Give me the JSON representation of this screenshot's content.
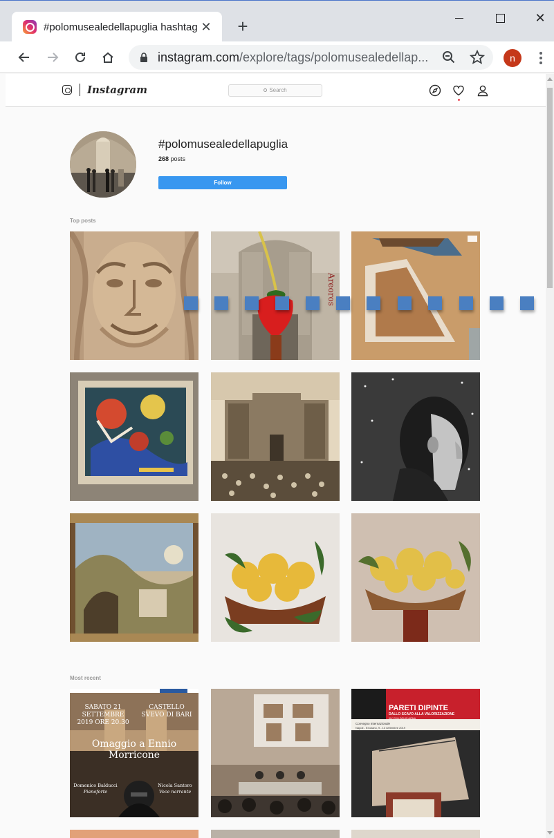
{
  "browser": {
    "tab_title": "#polomusealedellapuglia hashtag",
    "url_host": "instagram.com",
    "url_path": "/explore/tags/polomusealedellap...",
    "profile_initial": "n",
    "icons": [
      "instagram-favicon-icon",
      "close-icon",
      "plus-icon",
      "minimize-icon",
      "maximize-icon",
      "close-window-icon",
      "back-arrow-icon",
      "forward-arrow-icon",
      "reload-icon",
      "home-icon",
      "lock-icon",
      "zoom-icon",
      "star-icon",
      "kebab-menu-icon"
    ]
  },
  "instagram": {
    "wordmark": "Instagram",
    "search_placeholder": "Search",
    "icons": [
      "instagram-glyph-icon",
      "compass-icon",
      "heart-icon",
      "person-icon",
      "search-icon"
    ]
  },
  "hashtag": {
    "name": "#polomusealedellapuglia",
    "posts_count": "268",
    "posts_word": "posts",
    "follow_label": "Follow"
  },
  "sections": {
    "top_posts": "Top posts",
    "most_recent": "Most recent"
  },
  "posters": {
    "concert_date_left": "SABATO 21 SETTEMBRE 2019 ORE 20.30",
    "concert_venue": "CASTELLO SVEVO DI BARI",
    "concert_title": "Omaggio a Ennio Morricone",
    "performer_1_name": "Domenico Balducci",
    "performer_1_role": "Pianoforte",
    "performer_2_name": "Nicola Santoro",
    "performer_2_role": "Voce narrante",
    "pareti_title": "PARETI DIPINTE",
    "pareti_subtitle": "DALLO SCAVO ALLA VALORIZZAZIONE",
    "pareti_small": "XIV COLLOQUIO AIPMA",
    "pareti_event": "Convegno Internazionale",
    "pareti_place": "Napoli - Ercolano, 9 - 13 settembre 2019",
    "strawberry_word": "Areoros"
  },
  "colors": {
    "follow_blue": "#3897f0",
    "overlay_blue": "#4a7fc1",
    "pareti_red": "#c8202c"
  }
}
